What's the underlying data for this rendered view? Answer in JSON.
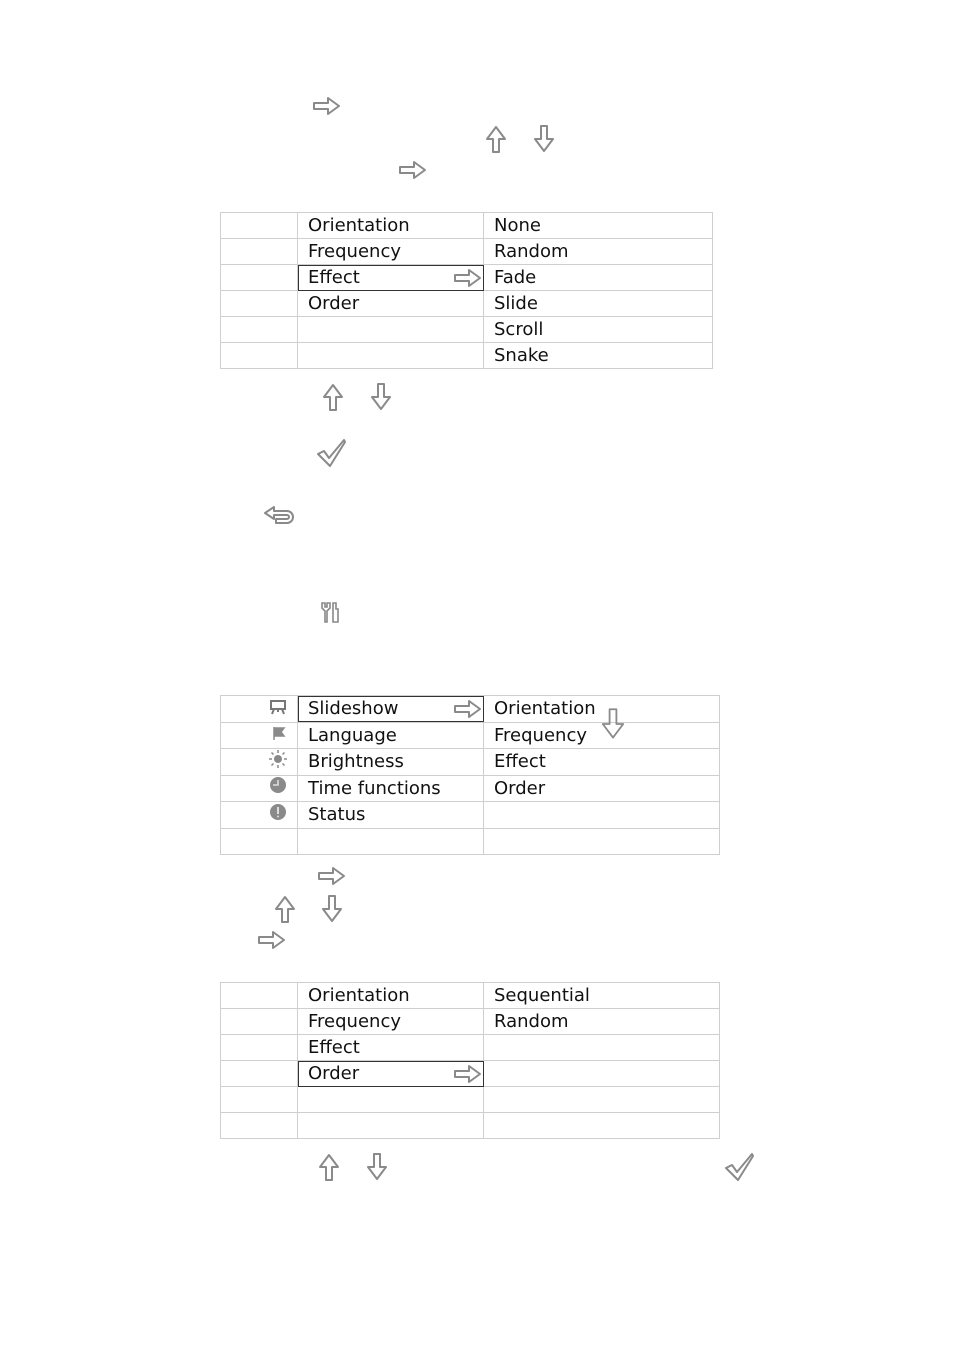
{
  "step_icons_top": [
    {
      "icon": "right-arrow-icon"
    },
    {
      "icon": "up-arrow-icon"
    },
    {
      "icon": "down-arrow-icon"
    },
    {
      "icon": "right-arrow-icon"
    }
  ],
  "effect_menu": {
    "rows": [
      {
        "label": "Orientation",
        "value": "None",
        "selected": false
      },
      {
        "label": "Frequency",
        "value": "Random",
        "selected": false
      },
      {
        "label": "Effect",
        "value": "Fade",
        "selected": true
      },
      {
        "label": "Order",
        "value": "Slide",
        "selected": false
      },
      {
        "label": "",
        "value": "Scroll",
        "selected": false
      },
      {
        "label": "",
        "value": "Snake",
        "selected": false
      }
    ]
  },
  "main_menu": {
    "rows": [
      {
        "icon": "slideshow-icon",
        "label": "Slideshow",
        "value": "Orientation",
        "selected": true
      },
      {
        "icon": "flag-icon",
        "label": "Language",
        "value": "Frequency",
        "selected": false
      },
      {
        "icon": "brightness-icon",
        "label": "Brightness",
        "value": "Effect",
        "selected": false
      },
      {
        "icon": "clock-icon",
        "label": "Time functions",
        "value": "Order",
        "selected": false
      },
      {
        "icon": "status-icon",
        "label": "Status",
        "value": "",
        "selected": false
      },
      {
        "icon": "",
        "label": "",
        "value": "",
        "selected": false
      }
    ]
  },
  "order_menu": {
    "rows": [
      {
        "label": "Orientation",
        "value": "Sequential",
        "selected": false
      },
      {
        "label": "Frequency",
        "value": "Random",
        "selected": false
      },
      {
        "label": "Effect",
        "value": "",
        "selected": false
      },
      {
        "label": "Order",
        "value": "",
        "selected": true
      },
      {
        "label": "",
        "value": "",
        "selected": false
      },
      {
        "label": "",
        "value": "",
        "selected": false
      }
    ]
  },
  "colors": {
    "icon_stroke": "#8a8a8a",
    "grid": "#cfcfcf",
    "selection": "#333333"
  }
}
